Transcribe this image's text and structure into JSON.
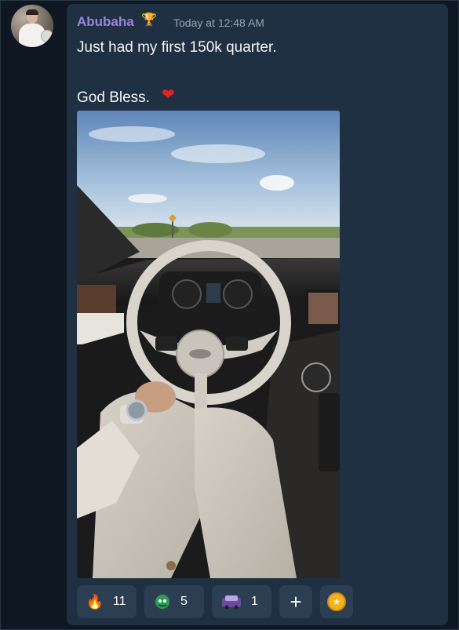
{
  "message": {
    "author": "Abubaha",
    "author_badge_icon": "trophy-icon",
    "timestamp": "Today at 12:48 AM",
    "text_line1": "Just had my first 150k quarter.",
    "text_line2": "God Bless.",
    "emoji": "❤"
  },
  "reactions": [
    {
      "icon": "fire-icon",
      "glyph": "🔥",
      "count": "11"
    },
    {
      "icon": "green-mask-icon",
      "glyph": "",
      "count": "5"
    },
    {
      "icon": "purple-car-icon",
      "glyph": "",
      "count": "1"
    }
  ],
  "add_reaction_icon": "plus-icon",
  "coin_icon": "gold-coin-icon",
  "colors": {
    "background": "#0e1722",
    "card": "#1f3042",
    "author": "#9b83dc",
    "pill": "#2c3e52"
  }
}
